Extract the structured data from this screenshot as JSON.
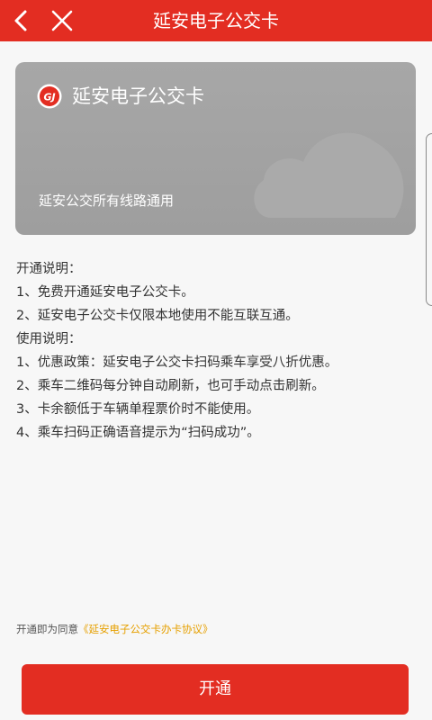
{
  "header": {
    "title": "延安电子公交卡",
    "back_icon": "chevron-left-icon",
    "close_icon": "close-icon",
    "background": "#e32d22"
  },
  "card": {
    "title": "延安电子公交卡",
    "subtitle": "延安公交所有线路通用",
    "logo_text": "GJ",
    "logo_icon": "bus-company-logo-icon",
    "background": "#a3a3a3"
  },
  "description": {
    "lines": [
      "开通说明：",
      "1、免费开通延安电子公交卡。",
      "2、延安电子公交卡仅限本地使用不能互联互通。",
      "使用说明：",
      "1、优惠政策：延安电子公交卡扫码乘车享受八折优惠。",
      "2、乘车二维码每分钟自动刷新，也可手动点击刷新。",
      "3、卡余额低于车辆单程票价时不能使用。",
      "4、乘车扫码正确语音提示为“扫码成功”。"
    ]
  },
  "agreement": {
    "prefix": "开通即为同意",
    "link_text": "《延安电子公交卡办卡协议》",
    "link_color": "#e6a000"
  },
  "actions": {
    "open_label": "开通",
    "color": "#e32d22"
  }
}
